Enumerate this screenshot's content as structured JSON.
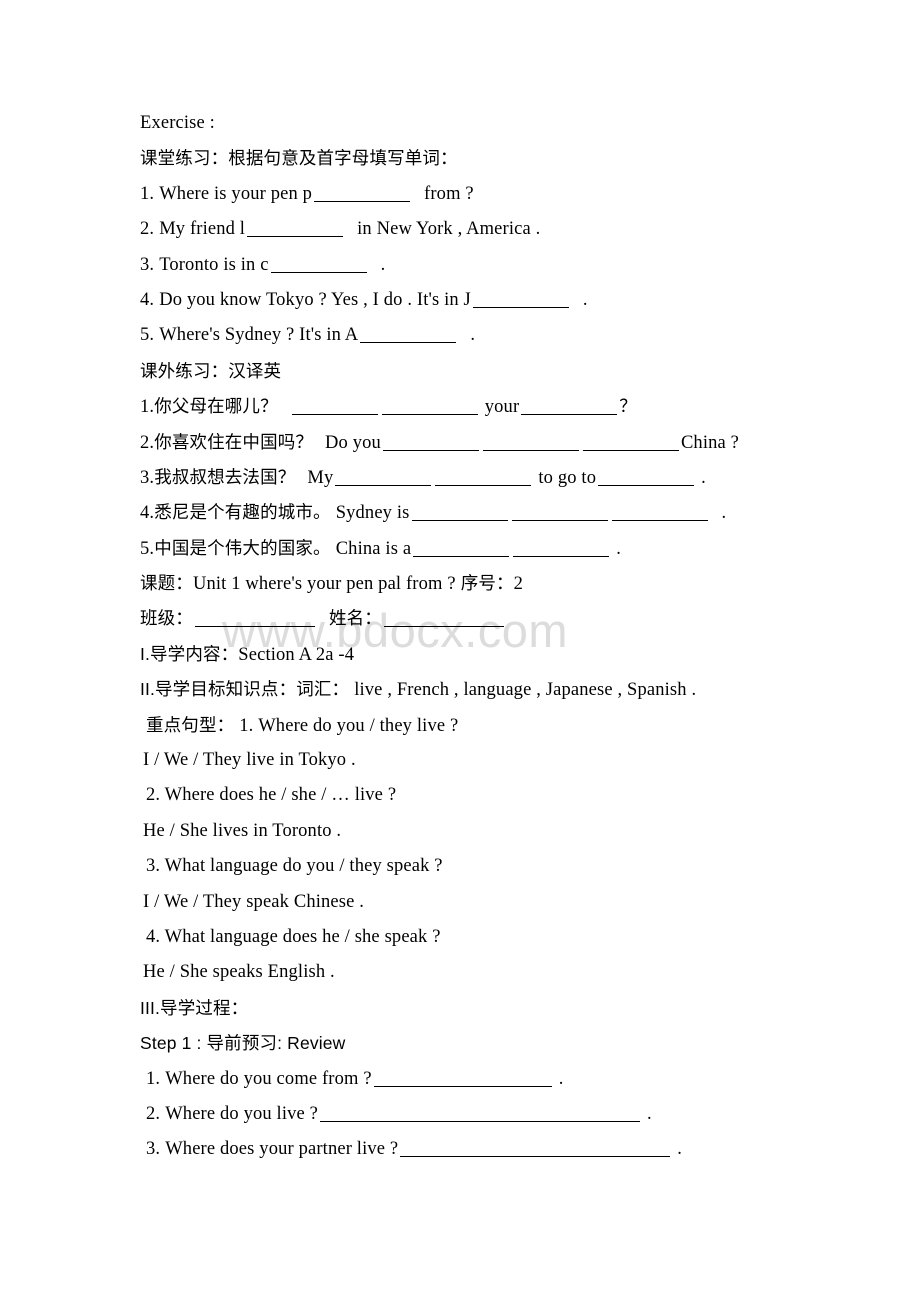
{
  "document": {
    "watermark": "www.bdocx.com",
    "watermark_color": "#dcdcdc",
    "page_background": "#ffffff",
    "text_color": "#000000"
  },
  "classroom_exercise": {
    "heading_en": "Exercise :",
    "heading_cn": "课堂练习：根据句意及首字母填写单词：",
    "items": [
      {
        "num": "1.",
        "before": "Where is your pen p",
        "after": "from ?"
      },
      {
        "num": "2.",
        "before": "My friend l",
        "after": "in New York , America ."
      },
      {
        "num": "3.",
        "before": "Toronto is in c",
        "after": "."
      },
      {
        "num": "4.",
        "before": "Do you know Tokyo ? Yes , I do . It's in J",
        "after": "."
      },
      {
        "num": "5.",
        "before": "Where's Sydney ? It's in A",
        "after": "."
      }
    ]
  },
  "outside_exercise": {
    "heading_cn": "课外练习：汉译英",
    "items": [
      {
        "num": "1.",
        "cn": "你父母在哪儿？",
        "mid": "your",
        "tail": "？"
      },
      {
        "num": "2.",
        "cn": "你喜欢住在中国吗？",
        "lead": "Do you",
        "tail": "China ?"
      },
      {
        "num": "3.",
        "cn": "我叔叔想去法国？",
        "lead": "My",
        "mid": "to go to",
        "tail": "."
      },
      {
        "num": "4.",
        "cn": "悉尼是个有趣的城市。",
        "lead": "Sydney is",
        "tail": "."
      },
      {
        "num": "5.",
        "cn": "中国是个伟大的国家。",
        "lead": "China is a",
        "tail": "."
      }
    ]
  },
  "lesson_header": {
    "topic_label": "课题：",
    "topic_value": "Unit 1 where's your pen pal from ?",
    "serial_label": "序号：",
    "serial_value": "2",
    "class_label": "班级：",
    "name_label": "姓名："
  },
  "guide_content": {
    "label": "I.导学内容：",
    "value": "Section A 2a -4"
  },
  "guide_objectives": {
    "label": "II.导学目标知识点：",
    "vocab_label": "词汇：",
    "vocab_value": "live , French , language , Japanese , Spanish .",
    "patterns_label": "重点句型：",
    "patterns": [
      "1. Where do you / they live ?",
      "I / We / They live in Tokyo .",
      "2. Where does he / she / … live ?",
      "He / She lives in Toronto .",
      "3. What language do you / they speak ?",
      "I / We / They speak Chinese .",
      "4. What language does he / she speak ?",
      "He / She speaks English ."
    ]
  },
  "guide_process": {
    "label": "III.导学过程：",
    "step1": "Step 1 : 导前预习: Review",
    "questions": [
      {
        "num": "1.",
        "text": "Where do you come from ?",
        "tail": "."
      },
      {
        "num": "2.",
        "text": "Where do you live ?",
        "tail": "."
      },
      {
        "num": "3.",
        "text": "Where does your partner live ?",
        "tail": "."
      }
    ]
  }
}
